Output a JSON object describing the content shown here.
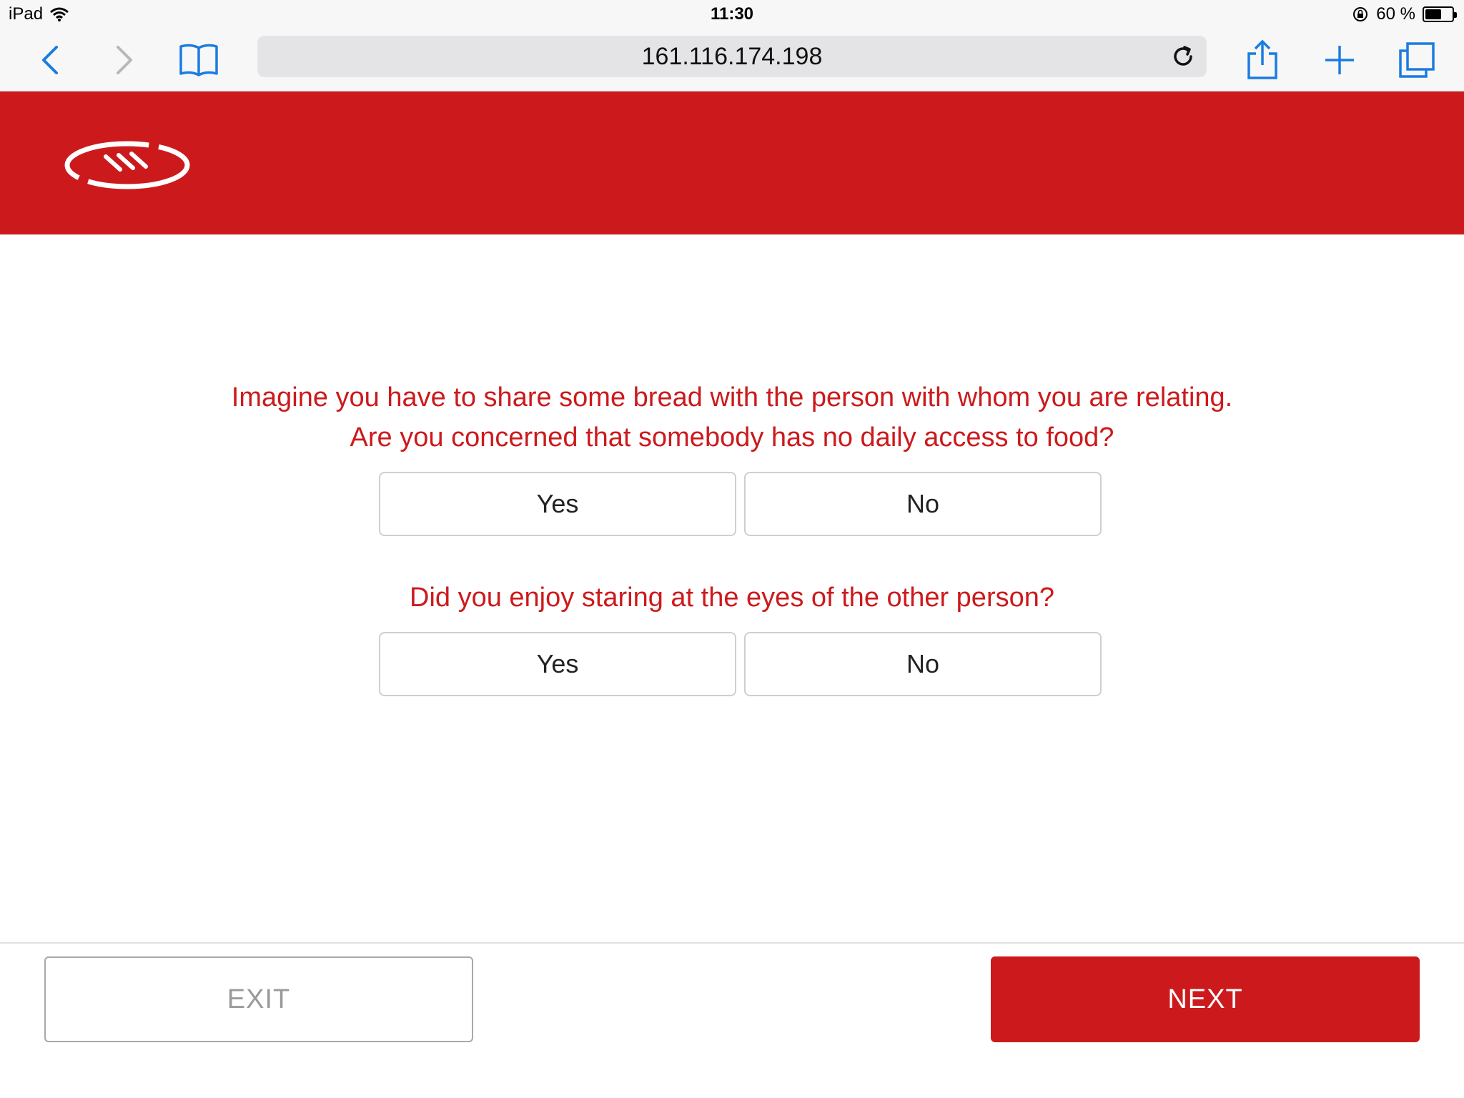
{
  "status_bar": {
    "device": "iPad",
    "time": "11:30",
    "battery": "60 %",
    "battery_level": 0.6
  },
  "browser": {
    "url": "161.116.174.198",
    "accent_color": "#1a7ce0"
  },
  "header": {
    "brand_color": "#cc1a1c"
  },
  "questions": [
    {
      "line1": "Imagine you have to share some bread with the person with whom you are relating.",
      "line2": "Are you concerned that somebody has no daily access to food?",
      "yes_label": "Yes",
      "no_label": "No"
    },
    {
      "line1": "Did you enjoy staring at the eyes of the other person?",
      "yes_label": "Yes",
      "no_label": "No"
    }
  ],
  "footer": {
    "exit_label": "EXIT",
    "next_label": "NEXT"
  }
}
